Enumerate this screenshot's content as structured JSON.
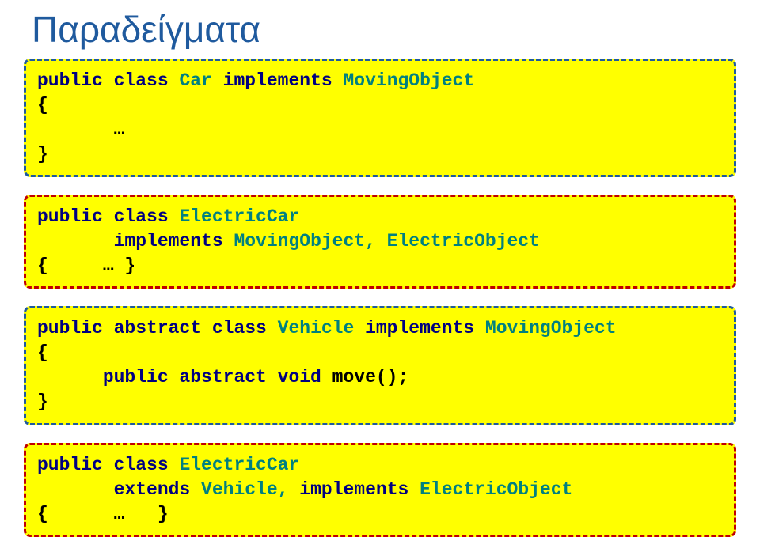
{
  "title": "Παραδείγματα",
  "b1": {
    "l1a": "public class ",
    "l1b": "Car ",
    "l1c": "implements ",
    "l1d": "MovingObject",
    "l2": "{",
    "l3": "       …",
    "l4": "}"
  },
  "b2": {
    "l1a": "public class ",
    "l1b": "ElectricCar",
    "l2a": "       implements ",
    "l2b": "MovingObject, ElectricObject",
    "l3": "{     … }"
  },
  "b3": {
    "l1a": "public abstract class ",
    "l1b": "Vehicle ",
    "l1c": "implements ",
    "l1d": "MovingObject",
    "l2": "{",
    "l3a": "      public abstract void ",
    "l3b": "move();",
    "l4": "}"
  },
  "b4": {
    "l1a": "public class ",
    "l1b": "ElectricCar",
    "l2a": "       extends ",
    "l2b": "Vehicle, ",
    "l2c": "implements ",
    "l2d": "ElectricObject",
    "l3": "{      …   }"
  }
}
